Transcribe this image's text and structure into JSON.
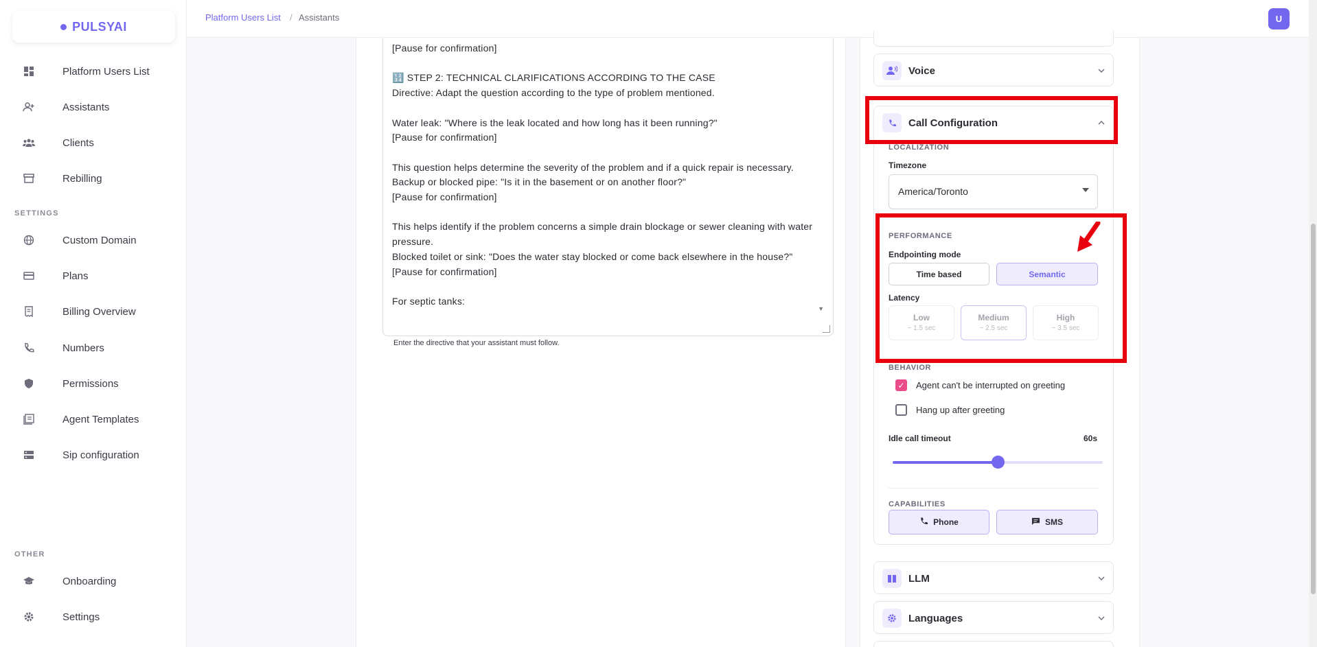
{
  "brand": {
    "name": "PULSYAI",
    "accent": "#7367f0"
  },
  "sidebar": {
    "main_items": [
      {
        "label": "Platform Users List",
        "icon": "dashboard-icon"
      },
      {
        "label": "Assistants",
        "icon": "user-plus-icon"
      },
      {
        "label": "Clients",
        "icon": "users-icon"
      },
      {
        "label": "Rebilling",
        "icon": "storefront-icon"
      }
    ],
    "settings_title": "SETTINGS",
    "settings_items": [
      {
        "label": "Custom Domain",
        "icon": "globe-icon"
      },
      {
        "label": "Plans",
        "icon": "credit-card-icon"
      },
      {
        "label": "Billing Overview",
        "icon": "receipt-icon"
      },
      {
        "label": "Numbers",
        "icon": "phone-call-icon"
      },
      {
        "label": "Permissions",
        "icon": "shield-icon"
      },
      {
        "label": "Agent Templates",
        "icon": "templates-icon"
      },
      {
        "label": "Sip configuration",
        "icon": "server-icon"
      }
    ],
    "other_title": "OTHER",
    "other_items": [
      {
        "label": "Onboarding",
        "icon": "graduation-cap-icon"
      },
      {
        "label": "Settings",
        "icon": "gear-icon"
      }
    ]
  },
  "topbar": {
    "breadcrumb": [
      "Platform Users List",
      "Assistants"
    ],
    "breadcrumb_separator": "/",
    "avatar_initial": "U"
  },
  "directive": {
    "text": "[Pause for confirmation]\n\n🔢 STEP 2: TECHNICAL CLARIFICATIONS ACCORDING TO THE CASE\nDirective: Adapt the question according to the type of problem mentioned.\n\nWater leak: \"Where is the leak located and how long has it been running?\"\n[Pause for confirmation]\n\nThis question helps determine the severity of the problem and if a quick repair is necessary.\nBackup or blocked pipe: \"Is it in the basement or on another floor?\"\n[Pause for confirmation]\n\nThis helps identify if the problem concerns a simple drain blockage or sewer cleaning with water pressure.\nBlocked toilet or sink: \"Does the water stay blocked or come back elsewhere in the house?\"\n[Pause for confirmation]\n\nFor septic tanks:",
    "helper": "Enter the directive that your assistant must follow."
  },
  "accordions": {
    "voice": {
      "title": "Voice",
      "icon": "voice-icon",
      "expanded": false
    },
    "call_config": {
      "title": "Call Configuration",
      "icon": "phone-icon",
      "expanded": true
    },
    "llm": {
      "title": "LLM",
      "icon": "book-icon",
      "expanded": false
    },
    "languages": {
      "title": "Languages",
      "icon": "gear-icon",
      "expanded": false
    }
  },
  "call_config": {
    "localization_title": "LOCALIZATION",
    "timezone_label": "Timezone",
    "timezone_value": "America/Toronto",
    "performance_title": "PERFORMANCE",
    "endpointing_label": "Endpointing mode",
    "endpointing_options": [
      "Time based",
      "Semantic"
    ],
    "endpointing_selected": "Semantic",
    "latency_label": "Latency",
    "latency_options": [
      {
        "name": "Low",
        "sub": "~ 1.5 sec"
      },
      {
        "name": "Medium",
        "sub": "~ 2.5 sec"
      },
      {
        "name": "High",
        "sub": "~ 3.5 sec"
      }
    ],
    "behavior_title": "BEHAVIOR",
    "behavior_options": [
      {
        "label": "Agent can't be interrupted on greeting",
        "checked": true
      },
      {
        "label": "Hang up after greeting",
        "checked": false
      }
    ],
    "idle_timeout_label": "Idle call timeout",
    "idle_timeout_value": "60s",
    "idle_timeout_fraction": 0.5,
    "capabilities_title": "CAPABILITIES",
    "capabilities": [
      {
        "label": "Phone",
        "icon": "phone-call-icon"
      },
      {
        "label": "SMS",
        "icon": "message-icon"
      }
    ]
  },
  "colors": {
    "highlight": "#e8000f",
    "checkbox_checked": "#ea4c89"
  }
}
